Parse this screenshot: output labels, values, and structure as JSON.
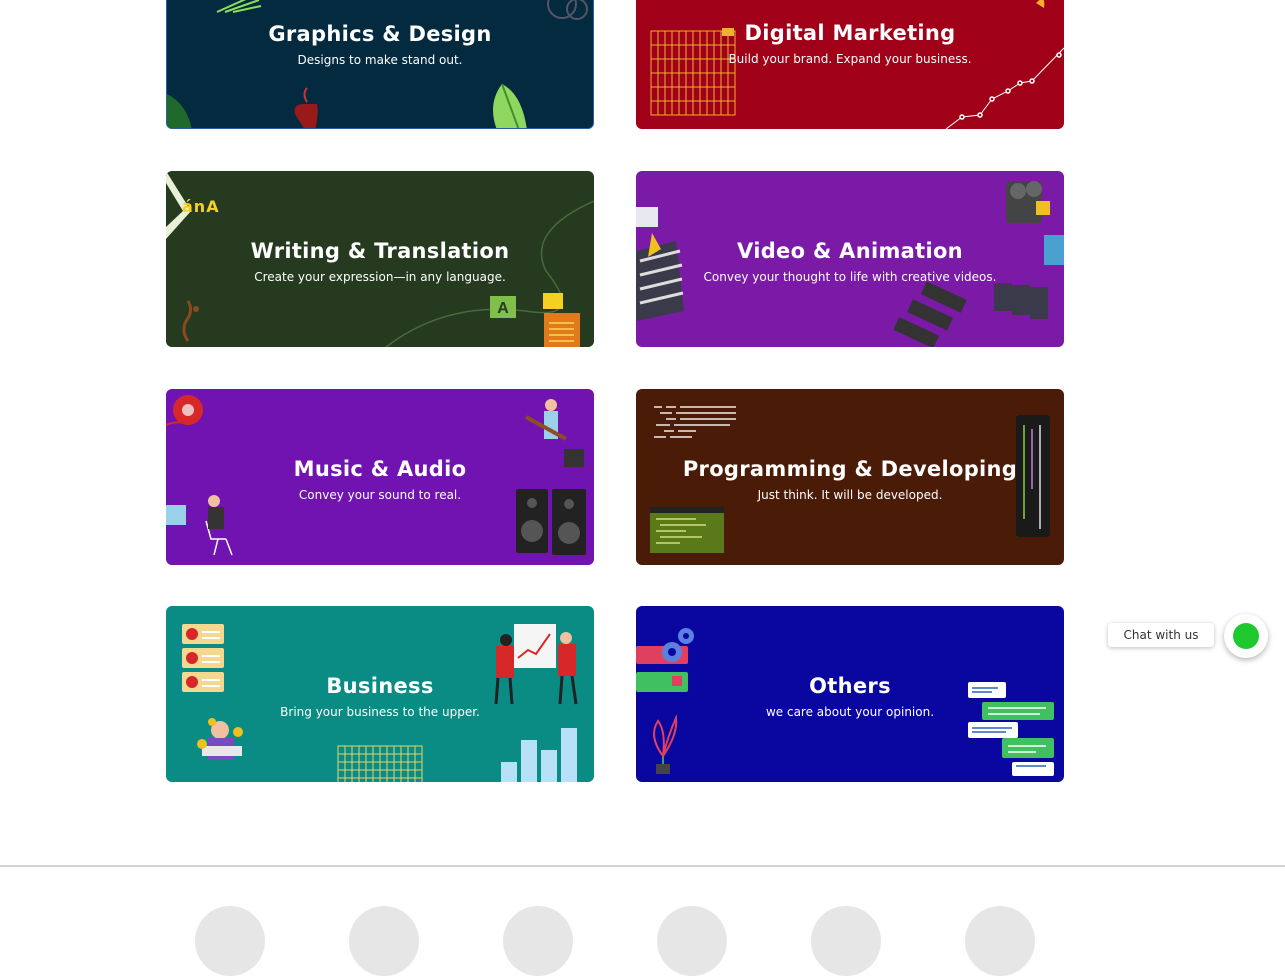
{
  "categories": [
    {
      "title": "Graphics & Design",
      "subtitle": "Designs to make stand out.",
      "color": "#042a40",
      "icon": "leaf-coffee-icon"
    },
    {
      "title": "Digital Marketing",
      "subtitle": "Build your brand. Expand your business.",
      "color": "#a00018",
      "icon": "growth-chart-icon"
    },
    {
      "title": "Writing & Translation",
      "subtitle": "Create your expression—in any language.",
      "color": "#253a1f",
      "icon": "translate-icon"
    },
    {
      "title": "Video & Animation",
      "subtitle": "Convey your thought to life with creative videos.",
      "color": "#7a1aa6",
      "icon": "film-camera-icon"
    },
    {
      "title": "Music & Audio",
      "subtitle": "Convey your sound to real.",
      "color": "#7013b0",
      "icon": "speaker-guitar-icon"
    },
    {
      "title": "Programming & Developing",
      "subtitle": "Just think. It will be developed.",
      "color": "#4a1c08",
      "icon": "code-editor-icon"
    },
    {
      "title": "Business",
      "subtitle": "Bring your business to the upper.",
      "color": "#0a8c85",
      "icon": "business-chart-icon"
    },
    {
      "title": "Others",
      "subtitle": "we care about your opinion.",
      "color": "#0a07a0",
      "icon": "chat-bubbles-icon"
    }
  ],
  "deco_glyphs": {
    "writing": "ánA"
  },
  "chat": {
    "label": "Chat with us",
    "color": "#1ec82f"
  }
}
